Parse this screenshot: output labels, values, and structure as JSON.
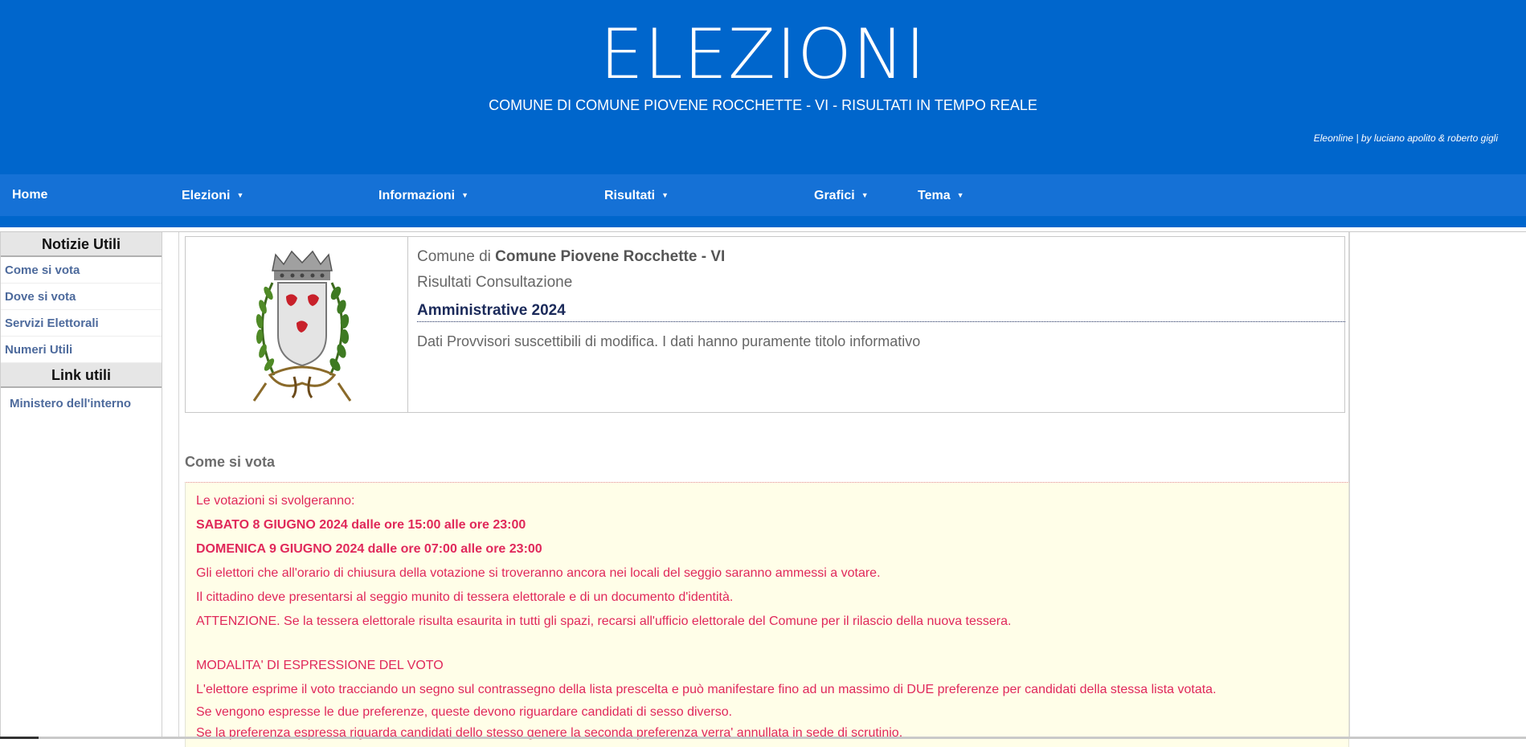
{
  "header": {
    "title": "ELEZIONI",
    "subtitle": "COMUNE DI COMUNE PIOVENE ROCCHETTE - VI - RISULTATI IN TEMPO REALE",
    "credits": "Eleonline | by luciano apolito & roberto gigli"
  },
  "nav": {
    "items": [
      {
        "label": "Home"
      },
      {
        "label": "Elezioni"
      },
      {
        "label": "Informazioni"
      },
      {
        "label": "Risultati"
      },
      {
        "label": "Grafici"
      },
      {
        "label": "Tema"
      }
    ],
    "caret": "▼"
  },
  "sidebar": {
    "notizie_title": "Notizie Utili",
    "notizie": [
      "Come si vota",
      "Dove si vota",
      "Servizi Elettorali",
      "Numeri Utili"
    ],
    "link_title": "Link utili",
    "links": [
      "Ministero dell'interno"
    ]
  },
  "info": {
    "comune_prefix": "Comune di",
    "comune_name": "Comune Piovene Rocchette - VI",
    "consultazione": "Risultati Consultazione",
    "election": "Amministrative 2024",
    "disclaimer": "Dati Provvisori suscettibili di modifica. I dati hanno puramente titolo informativo"
  },
  "section": {
    "title": "Come si vota",
    "lines": [
      "Le votazioni si svolgeranno:",
      "SABATO 8 GIUGNO 2024 dalle ore 15:00 alle ore 23:00",
      "DOMENICA 9 GIUGNO 2024 dalle ore 07:00 alle ore 23:00",
      "Gli elettori che all'orario di chiusura della votazione si troveranno ancora nei locali del seggio saranno ammessi a votare.",
      "Il cittadino deve presentarsi al seggio munito di tessera elettorale e di un documento d'identità.",
      "ATTENZIONE. Se la tessera elettorale risulta esaurita in tutti gli spazi, recarsi all'ufficio elettorale del Comune per il rilascio della nuova tessera.",
      "MODALITA' DI ESPRESSIONE DEL VOTO",
      "L'elettore esprime il voto tracciando un segno sul contrassegno della lista prescelta e può manifestare fino ad un massimo di DUE preferenze per candidati della stessa lista votata.",
      "Se vengono espresse le due preferenze, queste devono riguardare candidati di sesso diverso.",
      "Se la preferenza espressa riguarda candidati dello stesso genere la seconda preferenza verra' annullata in sede di scrutinio."
    ]
  }
}
